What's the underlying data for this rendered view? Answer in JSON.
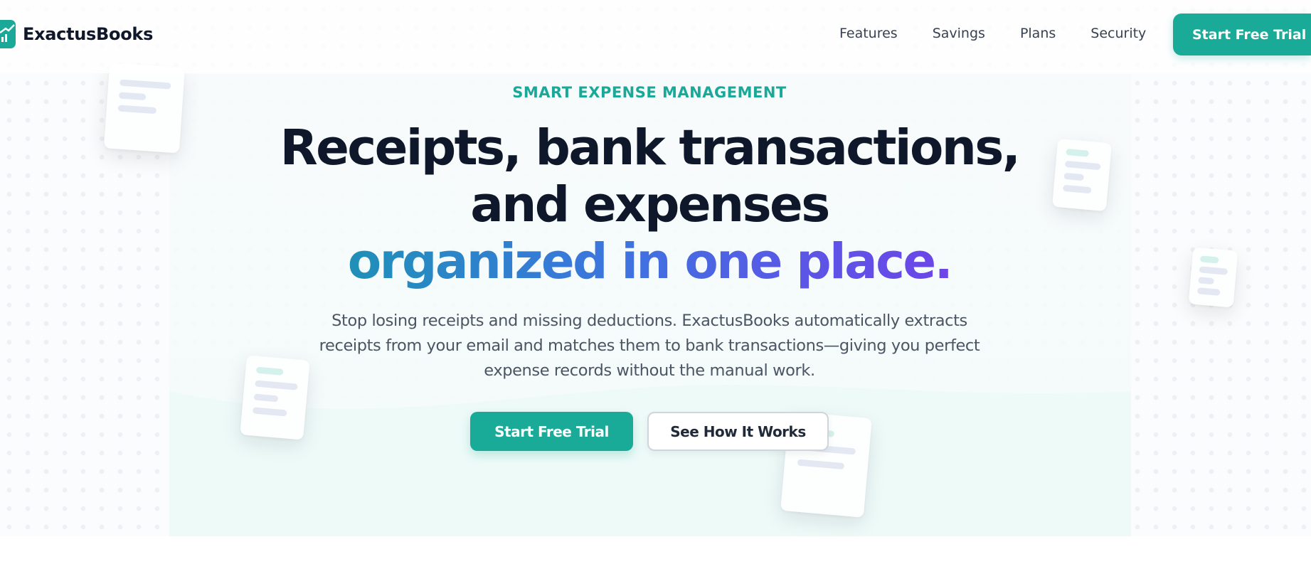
{
  "brand": {
    "name": "ExactusBooks",
    "accent_color": "#1aa999",
    "dark_text": "#0f172a"
  },
  "nav": {
    "items": [
      {
        "label": "Features"
      },
      {
        "label": "Savings"
      },
      {
        "label": "Plans"
      },
      {
        "label": "Security"
      }
    ],
    "cta_label": "Start Free Trial"
  },
  "hero": {
    "eyebrow": "SMART EXPENSE MANAGEMENT",
    "headline_line1": "Receipts, bank transactions,",
    "headline_line2": "and expenses",
    "headline_accent": "organized in one place.",
    "accent_gradient": [
      "#1f90b8",
      "#3d74e0",
      "#5b56e6",
      "#6d45e8"
    ],
    "subtext": "Stop losing receipts and missing deductions. ExactusBooks automatically extracts receipts from your email and matches them to bank transactions—giving you perfect expense records without the manual work.",
    "primary_cta": "Start Free Trial",
    "secondary_cta": "See How It Works"
  },
  "decorations": {
    "receipt_card_icon": "receipt-card-icon"
  }
}
